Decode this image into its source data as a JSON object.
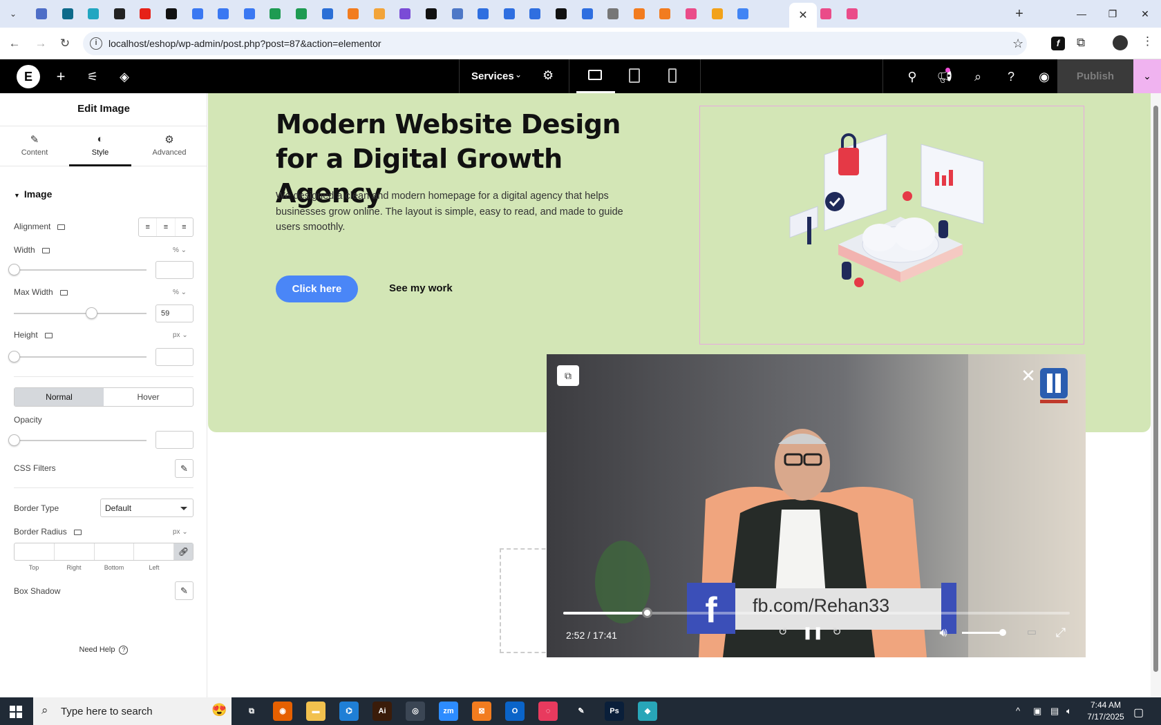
{
  "browser": {
    "tabs": [
      {
        "icon": "tab-icon",
        "color": "#4e6ec7"
      },
      {
        "icon": "wordpress-icon",
        "color": "#0e6a8a"
      },
      {
        "icon": "tab-icon",
        "color": "#22a6c1"
      },
      {
        "icon": "openai-icon",
        "color": "#222222"
      },
      {
        "icon": "youtube-icon",
        "color": "#e62117"
      },
      {
        "icon": "bolt-icon",
        "color": "#111111"
      },
      {
        "icon": "docs-icon",
        "color": "#3a78f2"
      },
      {
        "icon": "docs-icon",
        "color": "#3a78f2"
      },
      {
        "icon": "docs-icon",
        "color": "#3a78f2"
      },
      {
        "icon": "sheets-icon",
        "color": "#1e9b52"
      },
      {
        "icon": "sheets-icon",
        "color": "#1e9b52"
      },
      {
        "icon": "tab-icon",
        "color": "#2b6fd6"
      },
      {
        "icon": "xampp-icon",
        "color": "#f27c1f"
      },
      {
        "icon": "tab-icon",
        "color": "#f2a43a"
      },
      {
        "icon": "code-icon",
        "color": "#7a4bd6"
      },
      {
        "icon": "tab-icon",
        "color": "#111111"
      },
      {
        "icon": "tab-icon",
        "color": "#4e78c7"
      },
      {
        "icon": "tab-icon",
        "color": "#2f6fe0"
      },
      {
        "icon": "tab-icon",
        "color": "#2f6fe0"
      },
      {
        "icon": "tab-icon",
        "color": "#2f6fe0"
      },
      {
        "icon": "tab-icon",
        "color": "#111111"
      },
      {
        "icon": "tab-icon",
        "color": "#2f6fe0"
      },
      {
        "icon": "globe-icon",
        "color": "#777777"
      },
      {
        "icon": "xampp-icon",
        "color": "#f27c1f"
      },
      {
        "icon": "xampp-icon",
        "color": "#f27c1f"
      },
      {
        "icon": "dribbble-icon",
        "color": "#ea4c89"
      },
      {
        "icon": "chrome-icon",
        "color": "#f2a21a"
      },
      {
        "icon": "google-icon",
        "color": "#4285f4"
      },
      {
        "icon": "dribbble-icon",
        "color": "#ea4c89"
      },
      {
        "icon": "dribbble-icon",
        "color": "#ea4c89"
      },
      {
        "icon": "dribbble-icon",
        "color": "#ea4c89"
      }
    ],
    "active_tab_close": "✕",
    "new_tab": "+",
    "url": "localhost/eshop/wp-admin/post.php?post=87&action=elementor"
  },
  "elementor": {
    "document_title": "Services",
    "publish_label": "Publish"
  },
  "panel": {
    "title": "Edit Image",
    "tabs": [
      {
        "label": "Content",
        "icon": "pencil-icon"
      },
      {
        "label": "Style",
        "icon": "half-circle-icon"
      },
      {
        "label": "Advanced",
        "icon": "gear-icon"
      }
    ],
    "section": "Image",
    "alignment_label": "Alignment",
    "width_label": "Width",
    "width_unit": "%",
    "width_value": "",
    "max_width_label": "Max Width",
    "max_width_unit": "%",
    "max_width_value": "59",
    "height_label": "Height",
    "height_unit": "px",
    "height_value": "",
    "state_normal": "Normal",
    "state_hover": "Hover",
    "opacity_label": "Opacity",
    "opacity_value": "",
    "css_filters_label": "CSS Filters",
    "border_type_label": "Border Type",
    "border_type_value": "Default",
    "border_radius_label": "Border Radius",
    "border_radius_unit": "px",
    "radius_top": "Top",
    "radius_right": "Right",
    "radius_bottom": "Bottom",
    "radius_left": "Left",
    "box_shadow_label": "Box Shadow",
    "need_help": "Need Help"
  },
  "hero": {
    "title": "Modern Website Design for a Digital Growth Agency",
    "description": "We designed a clean and modern homepage for a digital agency that helps businesses grow online. The layout is simple, easy to read, and made to guide users smoothly.",
    "primary_button": "Click here",
    "secondary_button": "See my work"
  },
  "video": {
    "time": "2:52 / 17:41",
    "progress": 0.165,
    "banner_text": "fb.com/Rehan33"
  },
  "taskbar": {
    "search_placeholder": "Type here to search",
    "time": "7:44 AM",
    "date": "7/17/2025"
  }
}
